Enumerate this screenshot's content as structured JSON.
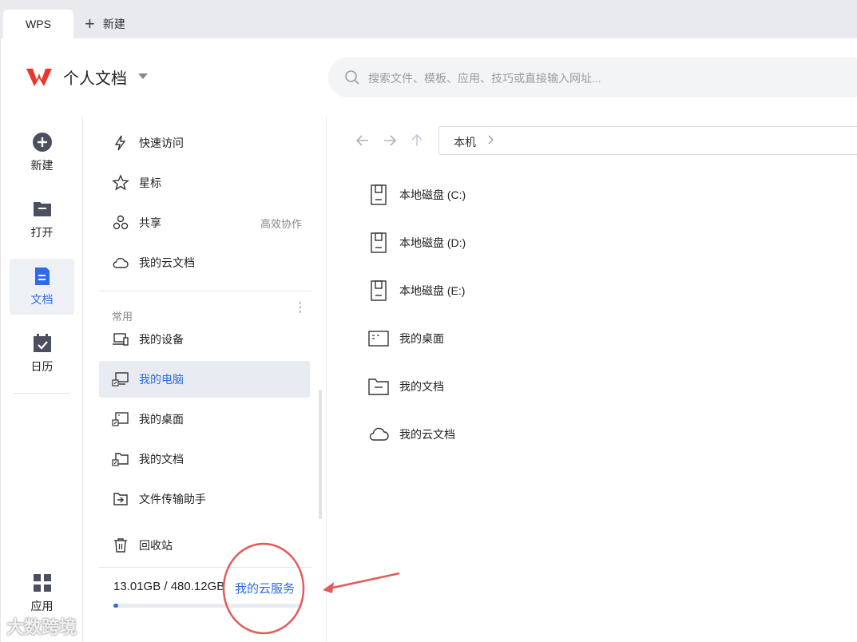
{
  "tabs": {
    "wps": "WPS",
    "new_tab": "新建"
  },
  "header": {
    "title": "个人文档",
    "search_placeholder": "搜索文件、模板、应用、技巧或直接输入网址..."
  },
  "rail": {
    "items": [
      {
        "label": "新建",
        "icon": "plus-circle-icon"
      },
      {
        "label": "打开",
        "icon": "folder-icon"
      },
      {
        "label": "文档",
        "icon": "document-icon",
        "active": true
      },
      {
        "label": "日历",
        "icon": "calendar-icon"
      }
    ],
    "apps_label": "应用"
  },
  "panel": {
    "quick": [
      {
        "label": "快速访问",
        "icon": "lightning-icon"
      },
      {
        "label": "星标",
        "icon": "star-icon"
      },
      {
        "label": "共享",
        "icon": "share-icon",
        "extra": "高效协作"
      },
      {
        "label": "我的云文档",
        "icon": "cloud-icon"
      }
    ],
    "section_title": "常用",
    "common": [
      {
        "label": "我的设备",
        "icon": "device-icon"
      },
      {
        "label": "我的电脑",
        "icon": "computer-icon",
        "selected": true
      },
      {
        "label": "我的桌面",
        "icon": "desktop-icon"
      },
      {
        "label": "我的文档",
        "icon": "documents-folder-icon"
      },
      {
        "label": "文件传输助手",
        "icon": "file-transfer-icon"
      }
    ],
    "recycle": "回收站",
    "storage_text": "13.01GB / 480.12GB",
    "cloud_service": "我的云服务",
    "storage_fraction": 0.027
  },
  "main": {
    "path": "本机",
    "files": [
      {
        "label": "本地磁盘 (C:)",
        "icon": "disk-icon"
      },
      {
        "label": "本地磁盘 (D:)",
        "icon": "disk-icon"
      },
      {
        "label": "本地磁盘 (E:)",
        "icon": "disk-icon"
      },
      {
        "label": "我的桌面",
        "icon": "desktop-icon"
      },
      {
        "label": "我的文档",
        "icon": "folder-icon"
      },
      {
        "label": "我的云文档",
        "icon": "cloud-icon"
      }
    ]
  },
  "watermark": "大数跨境",
  "colors": {
    "accent": "#2d6be4",
    "annotation": "#e45a5a",
    "logo": "#e8382b"
  }
}
